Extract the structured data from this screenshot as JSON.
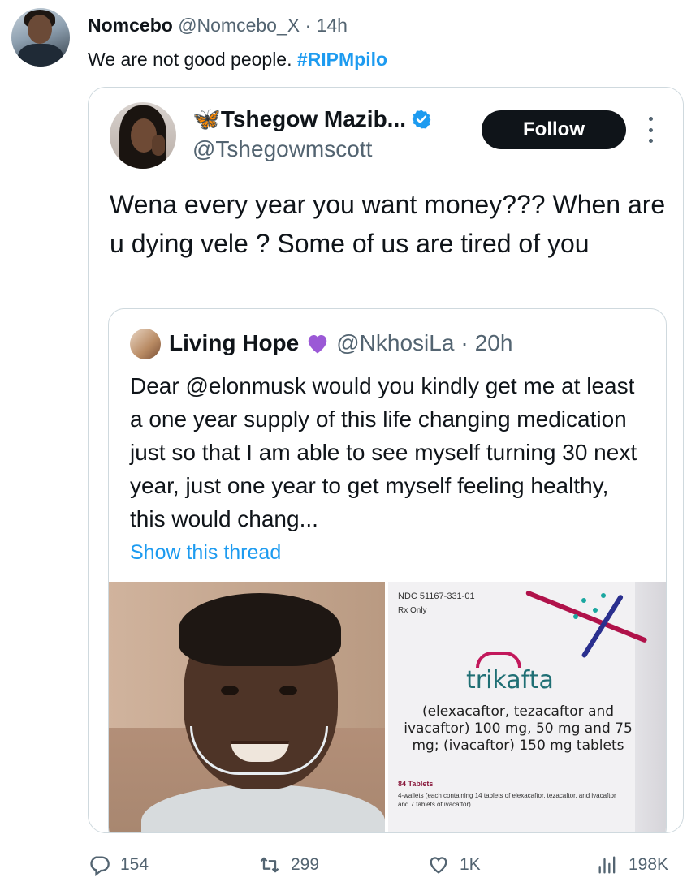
{
  "tweet": {
    "author_name": "Nomcebo",
    "author_handle": "@Nomcebo_X",
    "time": "14h",
    "text": "We are not good people. ",
    "hashtag": "#RIPMpilo"
  },
  "quoted": {
    "name": "🦋Tshegow Mazib...",
    "handle": "@Tshegowmscott",
    "follow_label": "Follow",
    "text": "Wena every year you want money??? When are u dying vele ? Some of us are tired of you"
  },
  "nested": {
    "name": "Living Hope",
    "handle": "@NkhosiLa",
    "time": "20h",
    "text": "Dear @elonmusk would you kindly get me at least a one year supply of this life changing medication just so that I am able to see myself turning 30 next year, just one year to get myself feeling healthy, this would chang...",
    "show_thread": "Show this thread"
  },
  "box": {
    "ndc": "NDC 51167-331-01",
    "rx": "Rx Only",
    "brand": "trikafta",
    "ingredients": "(elexacaftor, tezacaftor and ivacaftor) 100 mg, 50 mg and 75 mg; (ivacaftor) 150 mg tablets",
    "tablets": "84 Tablets",
    "wallets": "4-wallets (each containing 14 tablets of elexacaftor, tezacaftor, and ivacaftor and 7 tablets of ivacaftor)"
  },
  "actions": {
    "replies": "154",
    "retweets": "299",
    "likes": "1K",
    "views": "198K"
  },
  "colors": {
    "link": "#1d9bf0",
    "muted": "#536471",
    "verified": "#1d9bf0",
    "heart": "#9b59d6"
  }
}
